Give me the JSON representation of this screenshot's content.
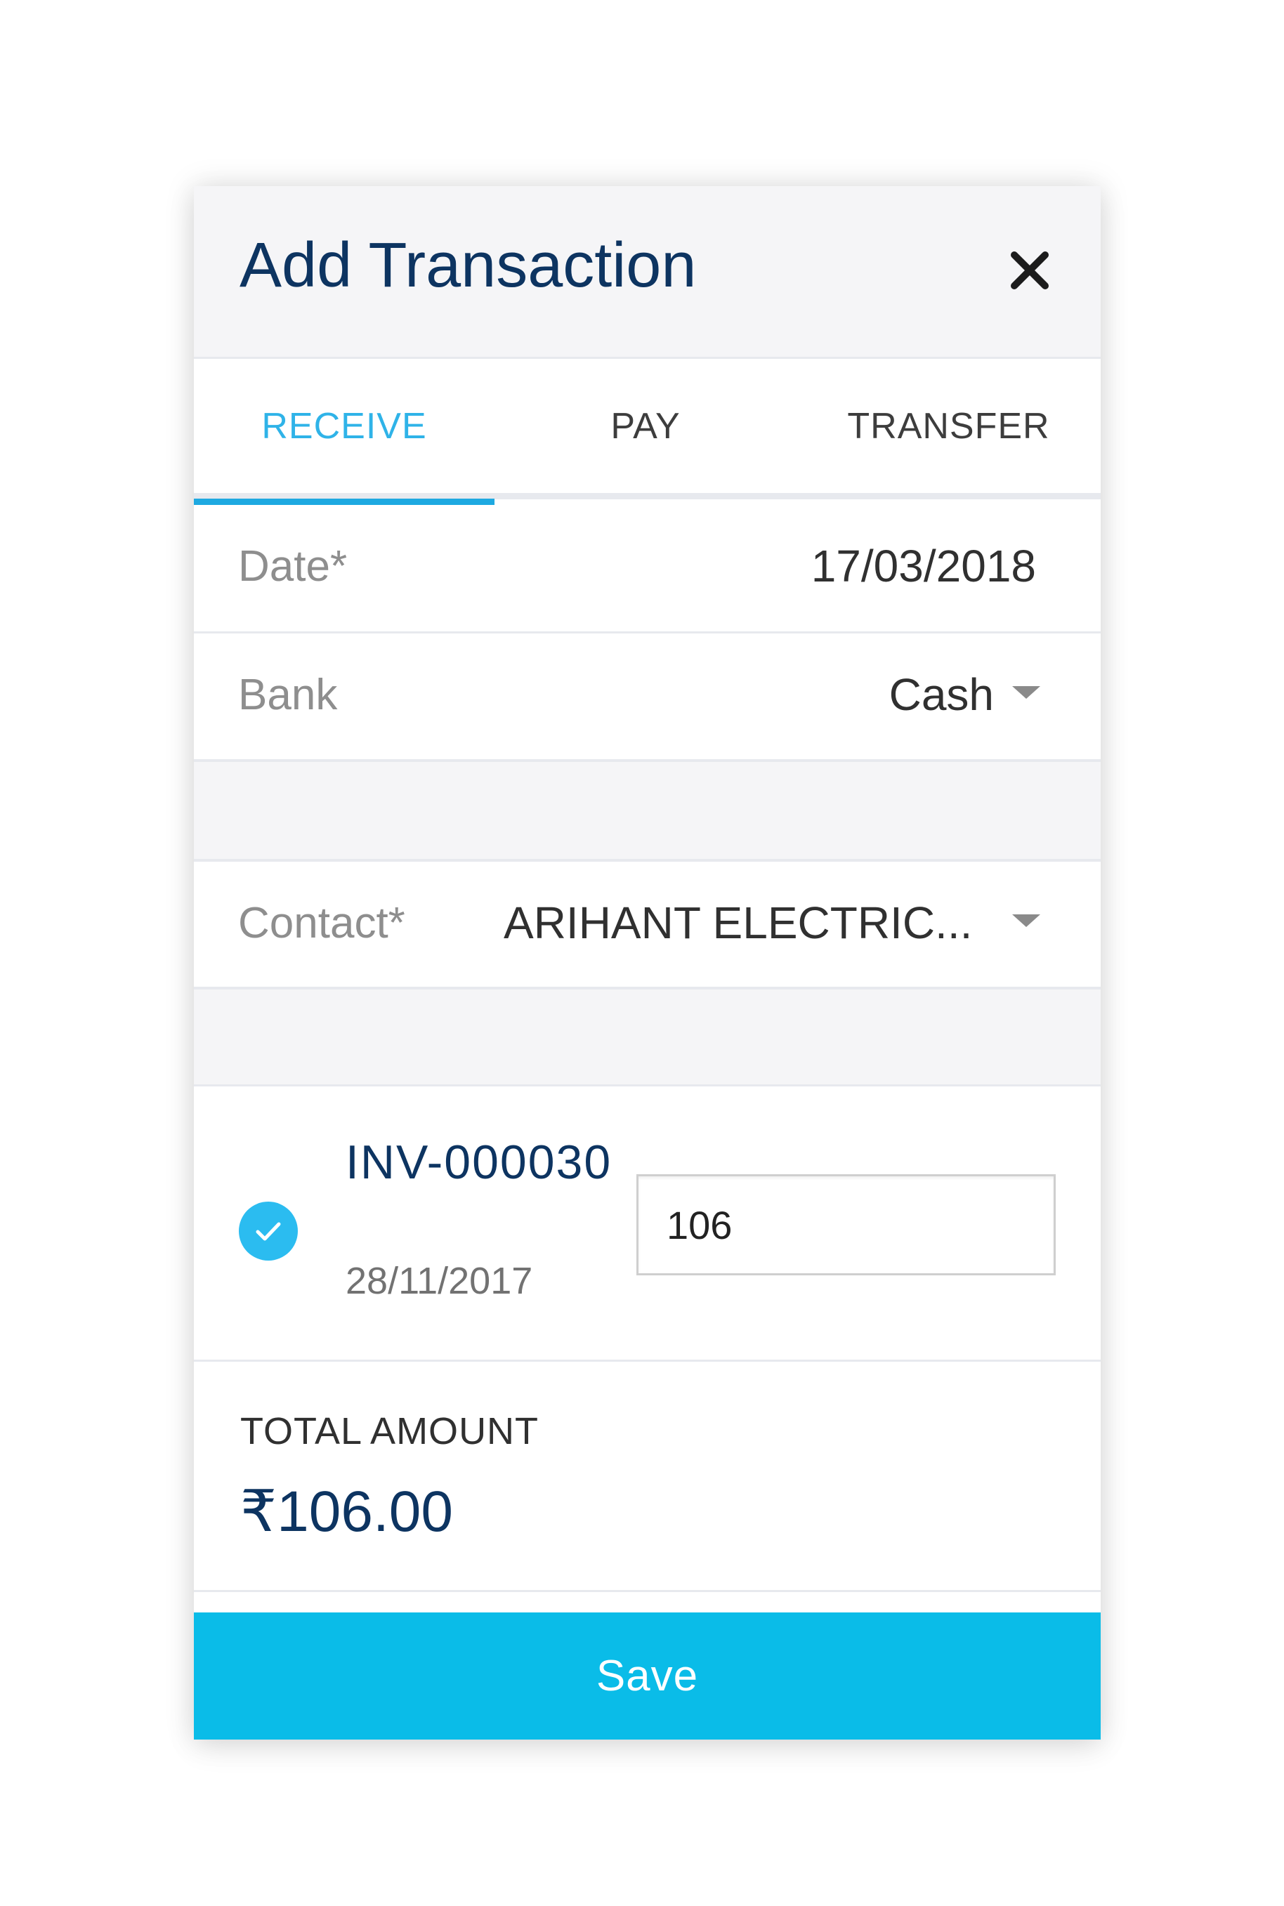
{
  "dialog": {
    "title": "Add Transaction"
  },
  "tabs": [
    {
      "label": "RECEIVE",
      "active": true
    },
    {
      "label": "PAY",
      "active": false
    },
    {
      "label": "TRANSFER",
      "active": false
    }
  ],
  "fields": {
    "date": {
      "label": "Date*",
      "value": "17/03/2018"
    },
    "bank": {
      "label": "Bank",
      "value": "Cash"
    },
    "contact": {
      "label": "Contact*",
      "value": "ARIHANT ELECTRIC..."
    }
  },
  "invoice": {
    "number": "INV-000030",
    "date": "28/11/2017",
    "checked": true,
    "amount": "106"
  },
  "total": {
    "label": "TOTAL AMOUNT",
    "value": "₹106.00"
  },
  "actions": {
    "save_label": "Save"
  },
  "colors": {
    "accent": "#0abce8",
    "title": "#0d3461",
    "active_tab": "#2fb3e8"
  },
  "icons": {
    "close": "close-icon",
    "dropdown": "caret-down-icon",
    "check": "check-icon"
  }
}
